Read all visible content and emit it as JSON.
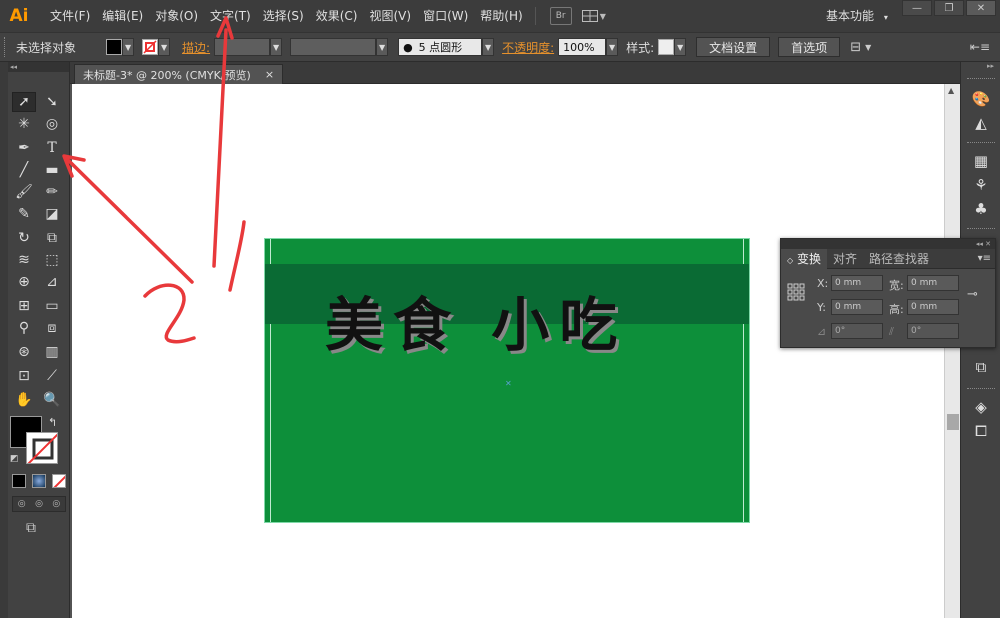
{
  "app": {
    "logo": "Ai",
    "workspace": "基本功能"
  },
  "menu": [
    "文件(F)",
    "编辑(E)",
    "对象(O)",
    "文字(T)",
    "选择(S)",
    "效果(C)",
    "视图(V)",
    "窗口(W)",
    "帮助(H)"
  ],
  "bridge_label": "Br",
  "window_buttons": {
    "minimize": "—",
    "restore": "❐",
    "close": "✕"
  },
  "control": {
    "selection": "未选择对象",
    "stroke_label": "描边:",
    "brush_value": "5 点圆形",
    "opacity_label": "不透明度:",
    "opacity_value": "100%",
    "style_label": "样式:",
    "doc_setup": "文档设置",
    "preferences": "首选项"
  },
  "document_tab": {
    "title": "未标题-3* @ 200% (CMYK/预览)",
    "close": "×"
  },
  "artboard": {
    "headline": "美食 小吃",
    "fill": "#0d8f3a",
    "band": "#0a6b34"
  },
  "transform_panel": {
    "tabs": [
      "变换",
      "对齐",
      "路径查找器"
    ],
    "x_label": "X:",
    "x_value": "0 mm",
    "w_label": "宽:",
    "w_value": "0 mm",
    "y_label": "Y:",
    "y_value": "0 mm",
    "h_label": "高:",
    "h_value": "0 mm",
    "rotate_value": "0°",
    "shear_value": "0°"
  },
  "annotation": {
    "color": "#e8393b",
    "number": "2"
  }
}
